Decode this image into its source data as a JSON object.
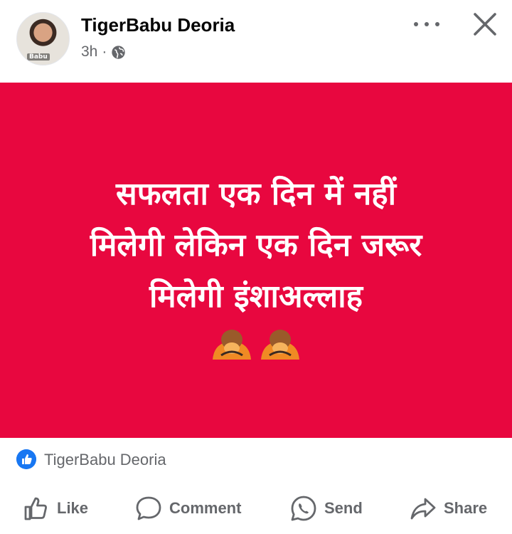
{
  "post": {
    "author_name": "TigerBabu Deoria",
    "avatar_tag": "Babu",
    "timestamp": "3h",
    "separator": "·",
    "privacy_icon": "globe-icon",
    "text_lines": [
      "सफलता एक दिन में नहीं",
      "मिलेगी लेकिन एक दिन जरूर",
      "मिलेगी इंशाअल्लाह"
    ],
    "emoji": [
      "person-bowing-emoji",
      "person-bowing-emoji"
    ],
    "background_color": "#e8073f"
  },
  "reactions": {
    "icon": "like-reaction-icon",
    "names": "TigerBabu Deoria"
  },
  "actions": {
    "like": "Like",
    "comment": "Comment",
    "send": "Send",
    "share": "Share"
  },
  "colors": {
    "accent": "#1877f2",
    "secondary_text": "#65676b"
  }
}
